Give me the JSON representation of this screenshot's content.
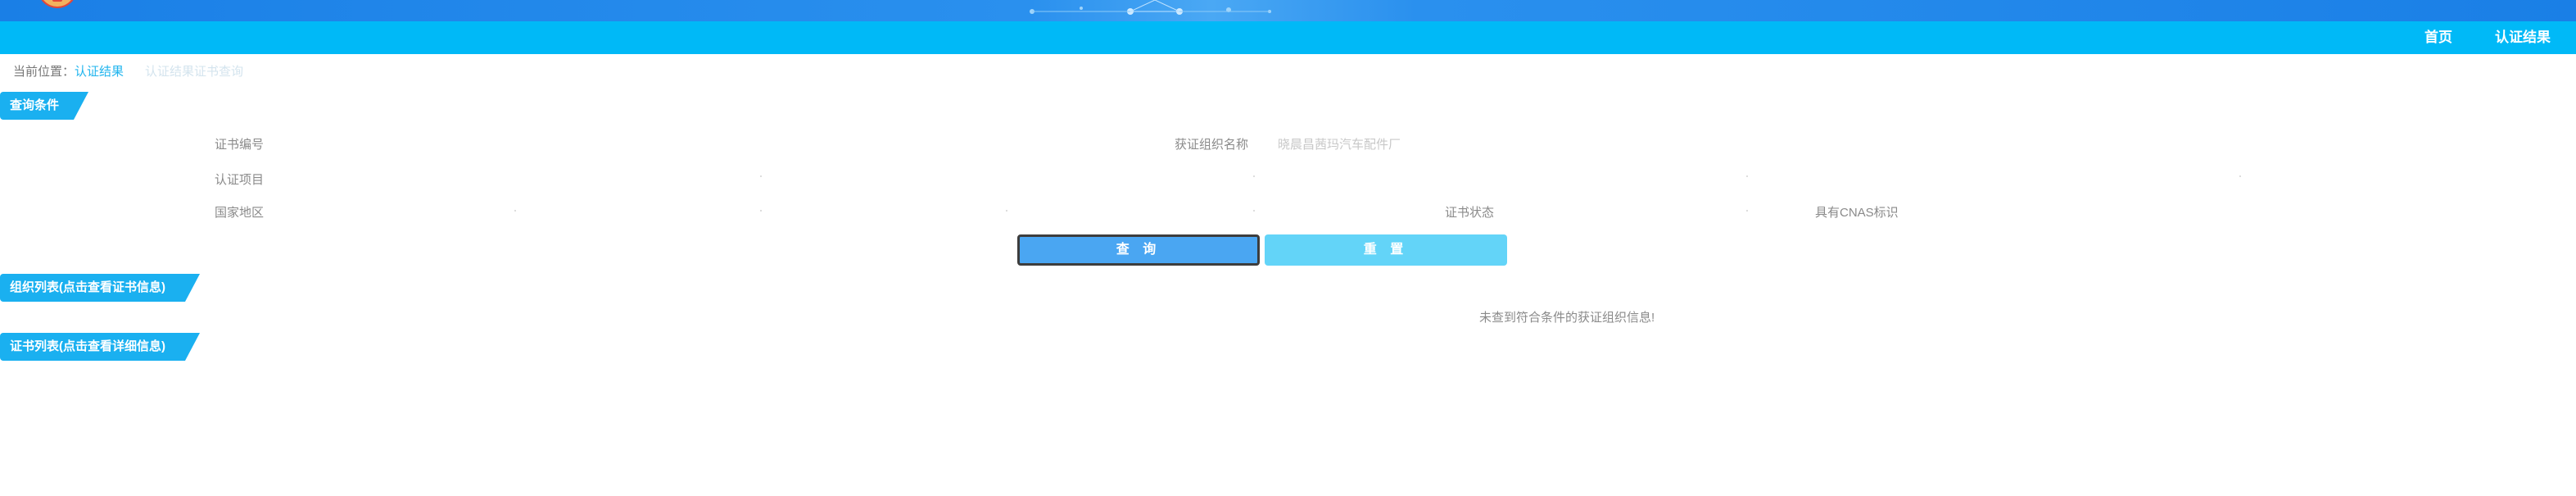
{
  "nav": {
    "home": "首页",
    "cert_result": "认证结果"
  },
  "breadcrumb": {
    "prefix": "当前位置：",
    "current": "认证结果",
    "sub": "认证结果证书查询"
  },
  "sections": {
    "query_conditions": "查询条件",
    "org_list": "组织列表(点击查看证书信息)",
    "cert_list": "证书列表(点击查看详细信息)"
  },
  "form": {
    "cert_number_label": "证书编号",
    "org_name_label": "获证组织名称",
    "org_name_value": "晓晨昌茜玛汽车配件厂",
    "cert_project_label": "认证项目",
    "country_label": "国家地区",
    "cert_status_label": "证书状态",
    "cnas_label": "具有CNAS标识"
  },
  "buttons": {
    "query": "查 询",
    "reset": "重 置"
  },
  "results": {
    "empty_message": "未查到符合条件的获证组织信息!"
  },
  "colors": {
    "banner": "#1a7fe6",
    "nav": "#00b9f7",
    "section_tab": "#1ab0f0",
    "query_button": "#4aa6f2",
    "reset_button": "#63d4f8"
  }
}
